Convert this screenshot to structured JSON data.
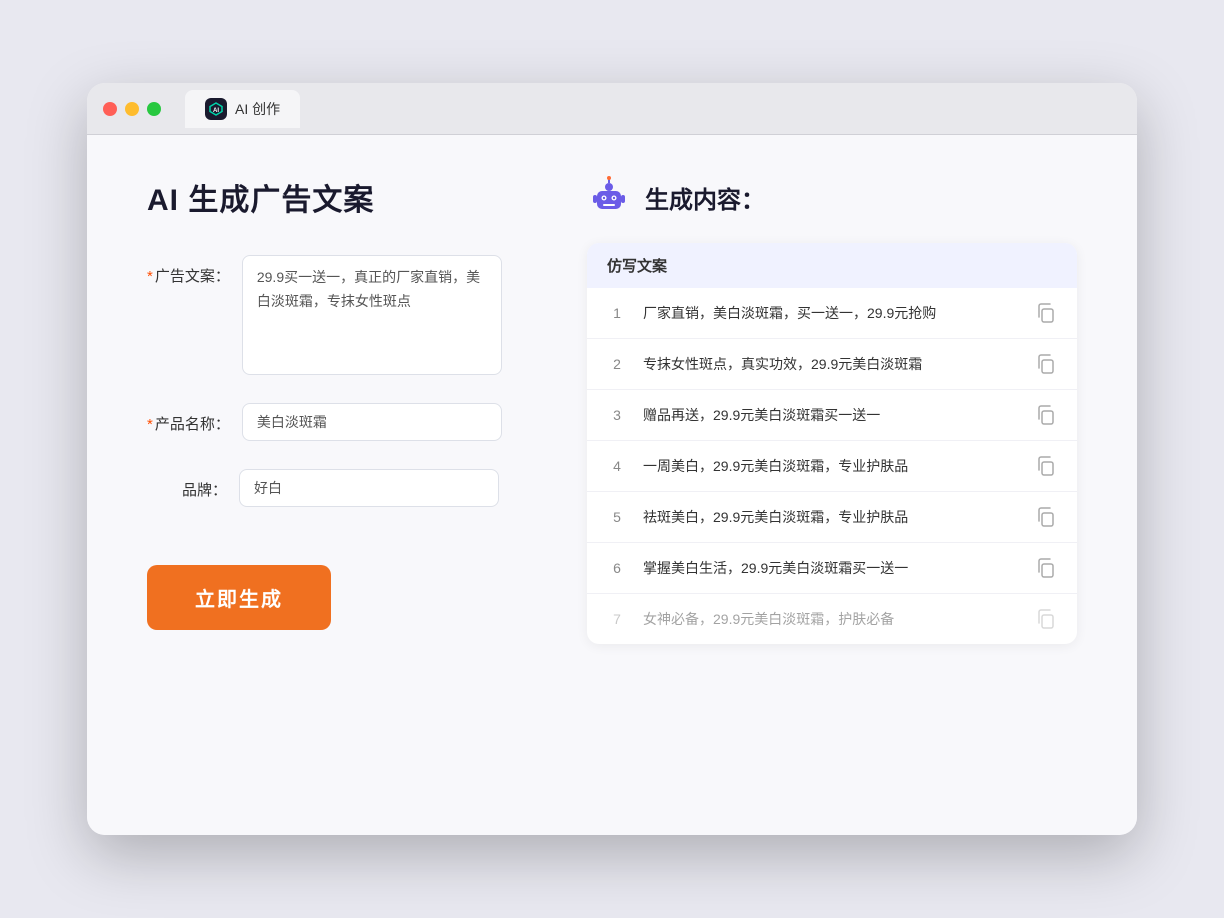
{
  "browser": {
    "tab_label": "AI 创作",
    "traffic_lights": [
      "red",
      "yellow",
      "green"
    ]
  },
  "left_panel": {
    "title": "AI 生成广告文案",
    "fields": [
      {
        "label": "广告文案：",
        "required": true,
        "type": "textarea",
        "value": "29.9买一送一，真正的厂家直销，美白淡斑霜，专抹女性斑点",
        "name": "ad-copy-input"
      },
      {
        "label": "产品名称：",
        "required": true,
        "type": "text",
        "value": "美白淡斑霜",
        "name": "product-name-input"
      },
      {
        "label": "品牌：",
        "required": false,
        "type": "text",
        "value": "好白",
        "name": "brand-input"
      }
    ],
    "button_label": "立即生成"
  },
  "right_panel": {
    "title": "生成内容：",
    "column_header": "仿写文案",
    "results": [
      {
        "number": "1",
        "text": "厂家直销，美白淡斑霜，买一送一，29.9元抢购",
        "dimmed": false
      },
      {
        "number": "2",
        "text": "专抹女性斑点，真实功效，29.9元美白淡斑霜",
        "dimmed": false
      },
      {
        "number": "3",
        "text": "赠品再送，29.9元美白淡斑霜买一送一",
        "dimmed": false
      },
      {
        "number": "4",
        "text": "一周美白，29.9元美白淡斑霜，专业护肤品",
        "dimmed": false
      },
      {
        "number": "5",
        "text": "祛斑美白，29.9元美白淡斑霜，专业护肤品",
        "dimmed": false
      },
      {
        "number": "6",
        "text": "掌握美白生活，29.9元美白淡斑霜买一送一",
        "dimmed": false
      },
      {
        "number": "7",
        "text": "女神必备，29.9元美白淡斑霜，护肤必备",
        "dimmed": true
      }
    ]
  }
}
